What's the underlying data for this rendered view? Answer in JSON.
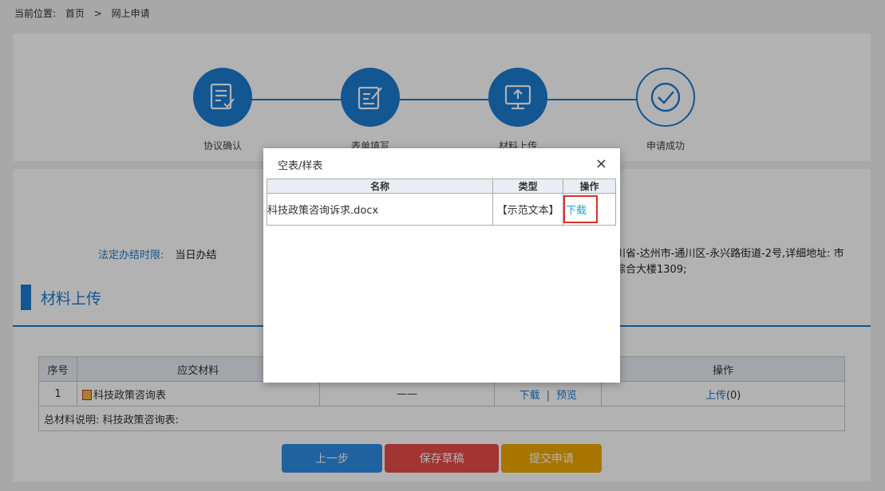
{
  "breadcrumb": {
    "prefix": "当前位置:",
    "home": "首页",
    "separator": ">",
    "current": "网上申请"
  },
  "steps": [
    {
      "label": "协议确认",
      "icon": "checklist-icon",
      "state": "active"
    },
    {
      "label": "表单填写",
      "icon": "edit-form-icon",
      "state": "active"
    },
    {
      "label": "材料上传",
      "icon": "upload-monitor-icon",
      "state": "active"
    },
    {
      "label": "申请成功",
      "icon": "check-circle-icon",
      "state": "pending"
    }
  ],
  "info": {
    "deadline_label": "法定办结时限:",
    "deadline_value": "当日办结",
    "address_line1": "川省-达州市-通川区-永兴路街道-2号,详细地址: 市",
    "address_line2": "综合大楼1309;"
  },
  "section": {
    "title": "材料上传"
  },
  "materials_table": {
    "headers": [
      "序号",
      "应交材料",
      "",
      "",
      "操作"
    ],
    "rows": [
      {
        "index": "1",
        "name": "科技政策咨询表",
        "spec": "——",
        "download": "下载",
        "separator": "|",
        "preview": "预览",
        "upload": "上传",
        "count": "(0)"
      }
    ],
    "note": "总材料说明: 科技政策咨询表:"
  },
  "buttons": {
    "prev": "上一步",
    "save": "保存草稿",
    "submit": "提交申请"
  },
  "colors": {
    "primary": "#1a7bd2",
    "prev_btn": "#2f8be6",
    "save_btn": "#e84b4b",
    "submit_btn": "#f0a800",
    "highlight_border": "#d9302a"
  },
  "modal": {
    "title": "空表/样表",
    "close": "×",
    "headers": [
      "名称",
      "类型",
      "操作"
    ],
    "rows": [
      {
        "name": "科技政策咨询诉求.docx",
        "type": "【示范文本】",
        "action": "下载"
      }
    ]
  }
}
